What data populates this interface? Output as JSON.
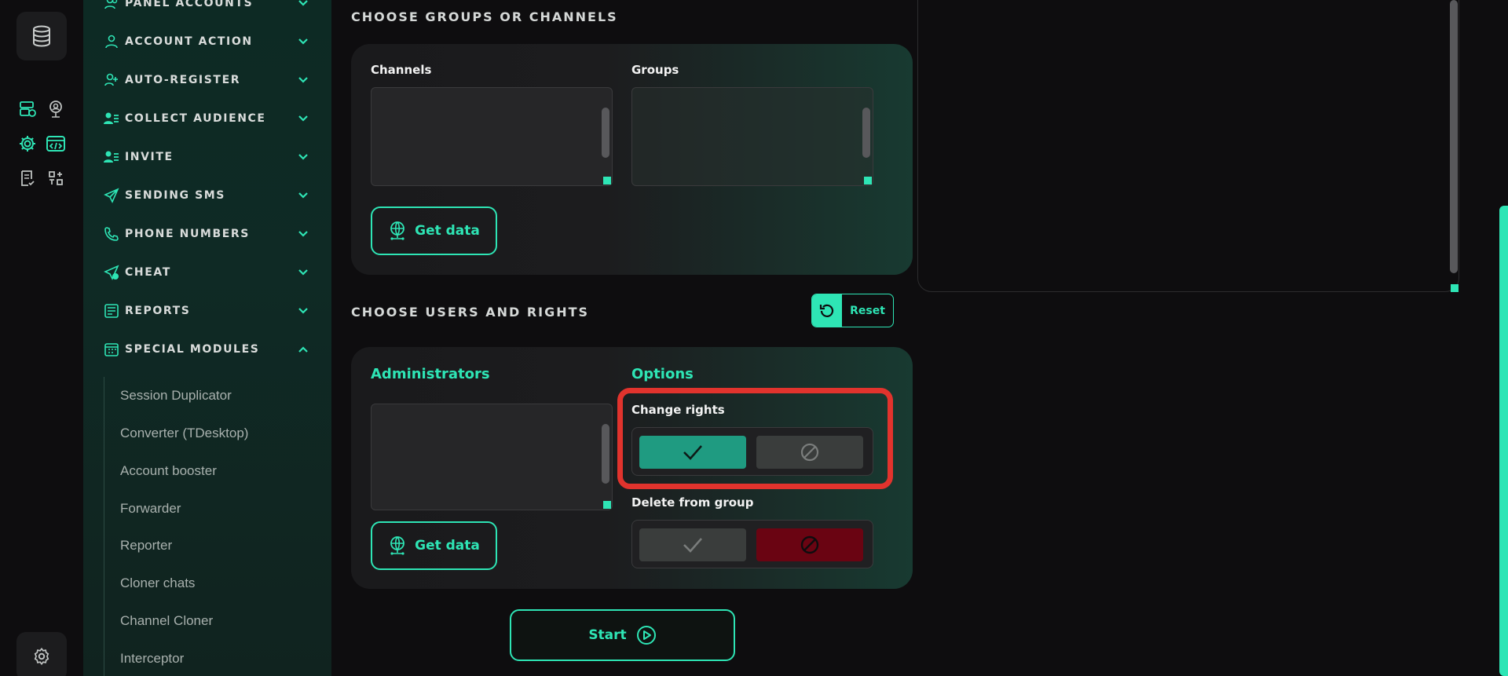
{
  "colors": {
    "accent": "#2ee5b5",
    "danger": "#e1332d",
    "active_toggle": "#1f9b81",
    "deny_active": "#6a0412"
  },
  "rail": {
    "icons": [
      "database-icon",
      "server-check-icon",
      "user-pin-icon",
      "settings-gear-icon",
      "code-window-icon",
      "checklist-icon",
      "shapes-icon",
      "settings-icon"
    ]
  },
  "sidebar": {
    "items": [
      {
        "label": "PANEL ACCOUNTS",
        "icon": "users-icon",
        "expanded": false
      },
      {
        "label": "ACCOUNT ACTION",
        "icon": "user-icon",
        "expanded": false
      },
      {
        "label": "AUTO-REGISTER",
        "icon": "user-plus-icon",
        "expanded": false
      },
      {
        "label": "COLLECT AUDIENCE",
        "icon": "user-list-icon",
        "expanded": false
      },
      {
        "label": "INVITE",
        "icon": "user-list-icon",
        "expanded": false
      },
      {
        "label": "SENDING SMS",
        "icon": "paper-plane-icon",
        "expanded": false
      },
      {
        "label": "PHONE NUMBERS",
        "icon": "phone-icon",
        "expanded": false
      },
      {
        "label": "CHEAT",
        "icon": "plane-plus-icon",
        "expanded": false
      },
      {
        "label": "REPORTS",
        "icon": "report-icon",
        "expanded": false
      },
      {
        "label": "SPECIAL MODULES",
        "icon": "calendar-grid-icon",
        "expanded": true
      }
    ],
    "sub_items": [
      "Session Duplicator",
      "Converter (TDesktop)",
      "Account booster",
      "Forwarder",
      "Reporter",
      "Cloner chats",
      "Channel Cloner",
      "Interceptor"
    ]
  },
  "groups_section": {
    "title": "CHOOSE GROUPS OR CHANNELS",
    "channels_label": "Channels",
    "groups_label": "Groups",
    "get_data_label": "Get data"
  },
  "users_section": {
    "title": "CHOOSE USERS AND RIGHTS",
    "reset_label": "Reset",
    "administrators_label": "Administrators",
    "options_label": "Options",
    "get_data_label": "Get data",
    "change_rights_label": "Change rights",
    "change_rights_value": "allow",
    "delete_from_group_label": "Delete from group",
    "delete_from_group_value": "deny"
  },
  "start_label": "Start"
}
